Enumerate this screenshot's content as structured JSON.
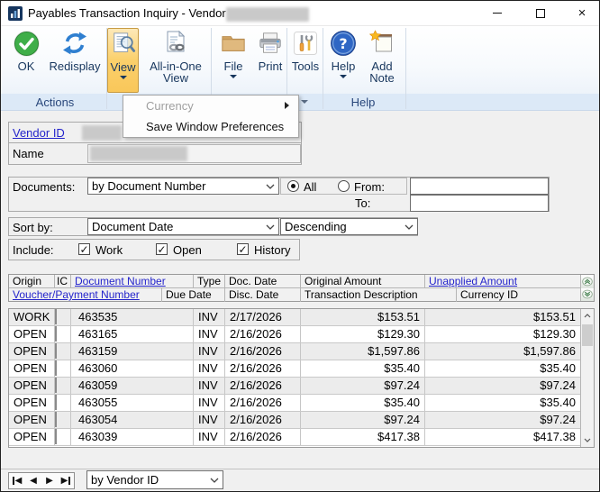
{
  "window": {
    "title": "Payables Transaction Inquiry - Vendor  -"
  },
  "icons": {
    "app": "bar-chart",
    "ok": "green-check-circle",
    "redisplay": "blue-refresh-arrows",
    "view": "document-magnifier",
    "all_in_one_view": "document-chain-links",
    "file": "folder",
    "print": "printer",
    "tools": "wrench-screwdriver",
    "help": "blue-question-circle",
    "add_note": "note-with-star",
    "minimize": "dash",
    "maximize": "square",
    "close": "×"
  },
  "colors": {
    "accent_pressed_orange": "#FBD06B",
    "link_blue": "#2323CB",
    "group_strip_blue": "#DCE9F7",
    "ok_green": "#3FAE49",
    "help_blue": "#2F66C4"
  },
  "ribbon": {
    "ok": "OK",
    "redisplay": "Redisplay",
    "view": "View",
    "all_in_one_view": "All-in-One View",
    "file": "File",
    "print": "Print",
    "tools": "Tools",
    "help": "Help",
    "add_note": "Add Note",
    "group_actions": "Actions",
    "group_help": "Help"
  },
  "menu": {
    "currency": "Currency",
    "save_window_preferences": "Save Window Preferences"
  },
  "vendor": {
    "id_label": "Vendor ID",
    "name_label": "Name"
  },
  "filters": {
    "documents_label": "Documents:",
    "documents_value": "by Document Number",
    "all_label": "All",
    "from_label": "From:",
    "to_label": "To:",
    "from_value": "",
    "to_value": "",
    "sortby_label": "Sort by:",
    "sortby_value": "Document Date",
    "direction_value": "Descending",
    "include_label": "Include:",
    "include_options": [
      "Work",
      "Open",
      "History"
    ]
  },
  "table": {
    "header_row1": [
      "Origin",
      "IC",
      "Document Number",
      "Type",
      "Doc. Date",
      "Original Amount",
      "Unapplied Amount"
    ],
    "header_row2": [
      "Voucher/Payment Number",
      "Due Date",
      "Disc. Date",
      "Transaction Description",
      "Currency ID"
    ],
    "rows": [
      {
        "origin": "WORK",
        "doc_number": "463535",
        "type": "INV",
        "doc_date": "2/17/2026",
        "original_amount": "$153.51",
        "unapplied_amount": "$153.51"
      },
      {
        "origin": "OPEN",
        "doc_number": "463165",
        "type": "INV",
        "doc_date": "2/16/2026",
        "original_amount": "$129.30",
        "unapplied_amount": "$129.30"
      },
      {
        "origin": "OPEN",
        "doc_number": "463159",
        "type": "INV",
        "doc_date": "2/16/2026",
        "original_amount": "$1,597.86",
        "unapplied_amount": "$1,597.86"
      },
      {
        "origin": "OPEN",
        "doc_number": "463060",
        "type": "INV",
        "doc_date": "2/16/2026",
        "original_amount": "$35.40",
        "unapplied_amount": "$35.40"
      },
      {
        "origin": "OPEN",
        "doc_number": "463059",
        "type": "INV",
        "doc_date": "2/16/2026",
        "original_amount": "$97.24",
        "unapplied_amount": "$97.24"
      },
      {
        "origin": "OPEN",
        "doc_number": "463055",
        "type": "INV",
        "doc_date": "2/16/2026",
        "original_amount": "$35.40",
        "unapplied_amount": "$35.40"
      },
      {
        "origin": "OPEN",
        "doc_number": "463054",
        "type": "INV",
        "doc_date": "2/16/2026",
        "original_amount": "$97.24",
        "unapplied_amount": "$97.24"
      },
      {
        "origin": "OPEN",
        "doc_number": "463039",
        "type": "INV",
        "doc_date": "2/16/2026",
        "original_amount": "$417.38",
        "unapplied_amount": "$417.38"
      }
    ]
  },
  "footer": {
    "browse_value": "by Vendor ID"
  }
}
